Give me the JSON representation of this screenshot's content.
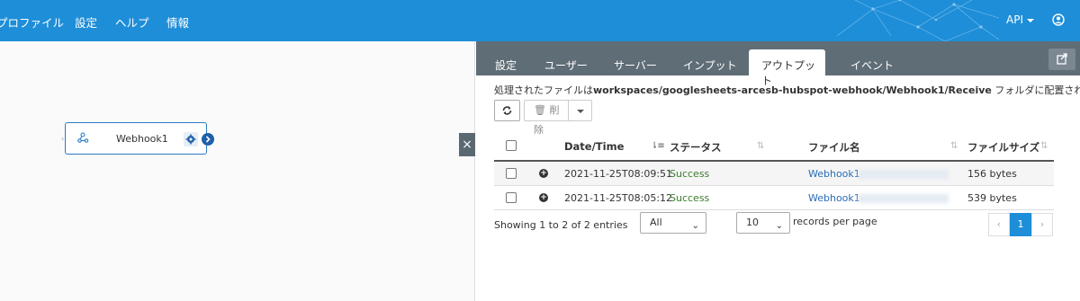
{
  "nav": {
    "items": [
      "プロファイル",
      "設定",
      "ヘルプ",
      "情報"
    ],
    "api_label": "API"
  },
  "canvas": {
    "node_label": "Webhook1",
    "collapse_label": "×"
  },
  "panel": {
    "tabs": [
      "設定",
      "ユーザー",
      "サーバー",
      "インプット",
      "アウトプット",
      "イベント"
    ],
    "active_tab": "アウトプット",
    "info_prefix": "処理されたファイルは",
    "info_path": "workspaces/googlesheets-arcesb-hubspot-webhook/Webhook1/Receive",
    "info_suffix": " フォルダに配置されます。",
    "delete_label": "削除",
    "columns": [
      "Date/Time",
      "ステータス",
      "ファイル名",
      "ファイルサイズ"
    ],
    "rows": [
      {
        "datetime": "2021-11-25T08:09:51",
        "status": "Success",
        "filename": "Webhook1-",
        "size": "156 bytes"
      },
      {
        "datetime": "2021-11-25T08:05:12",
        "status": "Success",
        "filename": "Webhook1-",
        "size": "539 bytes"
      }
    ],
    "showing": "Showing 1 to 2 of 2 entries",
    "filter_value": "All",
    "page_size": "10",
    "records_label": "records per page",
    "pager": {
      "prev": "‹",
      "current": "1",
      "next": "›"
    }
  },
  "icons": {
    "user": "user-circle-icon",
    "refresh": "refresh-icon",
    "trash": "trash-icon",
    "popout": "external-link-icon",
    "node": "webhook-icon",
    "gear": "gear-icon",
    "output_port": "chevron-right-icon"
  },
  "colors": {
    "topbar": "#1e8ed8",
    "tabbar": "#5f6d77",
    "success": "#3a7d2d",
    "link": "#2a6db5"
  }
}
